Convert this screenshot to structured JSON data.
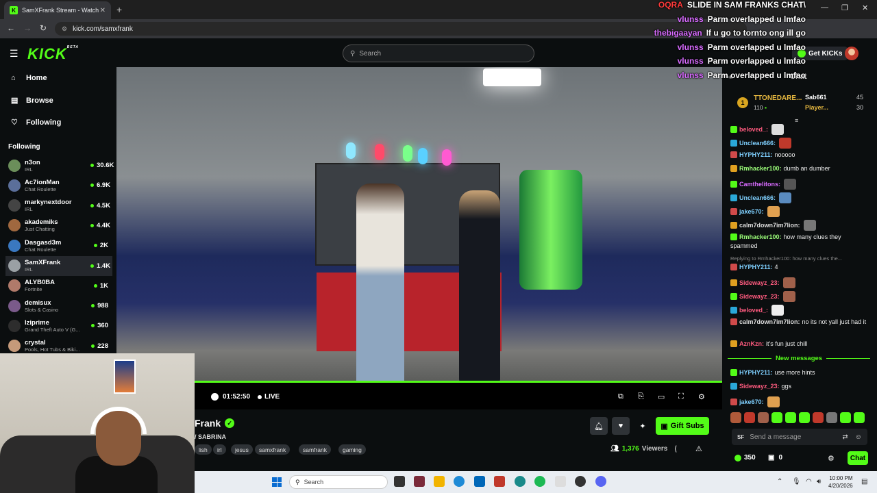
{
  "browser": {
    "tab_title": "SamXFrank Stream - Watch",
    "url": "kick.com/samxfrank",
    "tab_close": "✕",
    "new_tab": "+",
    "win_min": "—",
    "win_max": "❐",
    "win_close": "✕"
  },
  "header": {
    "logo": "KICK",
    "logo_tag": "BETA",
    "search_placeholder": "Search",
    "get_kicks_label": "Get KICKs"
  },
  "sidebar": {
    "nav": [
      {
        "label": "Home",
        "icon": "home-icon"
      },
      {
        "label": "Browse",
        "icon": "browse-icon"
      },
      {
        "label": "Following",
        "icon": "heart-icon"
      }
    ],
    "following_header": "Following",
    "following": [
      {
        "name": "n3on",
        "category": "IRL",
        "viewers": "30.6K",
        "color": "#6b8e5a"
      },
      {
        "name": "Ac7ionMan",
        "category": "Chat Roulette",
        "viewers": "6.9K",
        "color": "#5b6f9a"
      },
      {
        "name": "markynextdoor",
        "category": "IRL",
        "viewers": "4.5K",
        "color": "#444"
      },
      {
        "name": "akademiks",
        "category": "Just Chatting",
        "viewers": "4.4K",
        "color": "#a0683f"
      },
      {
        "name": "Dasgasd3m",
        "category": "Chat Roulette",
        "viewers": "2K",
        "color": "#3a78c0"
      },
      {
        "name": "SamXFrank",
        "category": "IRL",
        "viewers": "1.4K",
        "color": "#9aa0a4"
      },
      {
        "name": "ALYB0BA",
        "category": "Fortnite",
        "viewers": "1K",
        "color": "#b07a6a"
      },
      {
        "name": "demisux",
        "category": "Slots & Casino",
        "viewers": "988",
        "color": "#7a5a8a"
      },
      {
        "name": "lziprime",
        "category": "Grand Theft Auto V (G...",
        "viewers": "360",
        "color": "#2d2d2d"
      },
      {
        "name": "crystal",
        "category": "Pools, Hot Tubs & Biki...",
        "viewers": "228",
        "color": "#c59a7a"
      }
    ]
  },
  "player": {
    "time": "01:52:50",
    "live_label": "LIVE"
  },
  "stream": {
    "streamer_name": "Frank",
    "title": "/ SABRINA",
    "tags": [
      "lish",
      "irl",
      "jesus",
      "samxfrank",
      "samfrank",
      "gaming"
    ],
    "gift_subs_label": "Gift Subs",
    "viewers_count": "1,376",
    "viewers_label": "Viewers"
  },
  "overlay_chat": [
    {
      "user": "OQRA",
      "msg": "SLIDE IN SAM FRANKS CHAT\\",
      "color": "#ff3b3b"
    },
    {
      "user": "vlunss",
      "msg": "Parm overlapped u lmfao",
      "color": "#d86bff"
    },
    {
      "user": "thebigaayan",
      "msg": "If u go to tornto ong ill go",
      "color": "#d86bff"
    },
    {
      "user": "vlunss",
      "msg": "Parm overlapped u lmfao",
      "color": "#d86bff"
    },
    {
      "user": "vlunss",
      "msg": "Parm overlapped u lmfao",
      "color": "#d86bff"
    },
    {
      "user": "vlunss",
      "msg": "Parm overlapped u lmfao",
      "color": "#d86bff"
    }
  ],
  "chat": {
    "title": "Chat",
    "leader_rank": "1",
    "leader_name": "TTONEDARE...",
    "leader_count": "110",
    "leaderboard": [
      {
        "name": "Sab661",
        "value": "45"
      },
      {
        "name": "Player...",
        "value": "30"
      }
    ],
    "messages": [
      {
        "user": "beloved_:",
        "text": "",
        "color": "#ff5b7f",
        "emote": "#ddd"
      },
      {
        "user": "Unclean666:",
        "text": "",
        "color": "#7fd0ff",
        "emote": "#c0392b"
      },
      {
        "user": "HYPHY211:",
        "text": "nooooo",
        "color": "#7fd0ff",
        "emote": ""
      },
      {
        "user": "Rmhacker100:",
        "text": "dumb an dumber",
        "color": "#9cff7a",
        "emote": ""
      },
      {
        "user": "Camthelitons:",
        "text": "",
        "color": "#d86bff",
        "emote": "#555"
      },
      {
        "user": "Unclean666:",
        "text": "",
        "color": "#7fd0ff",
        "emote": "#5a8bbf"
      },
      {
        "user": "jake670:",
        "text": "",
        "color": "#7fd0ff",
        "emote": "#e0a050"
      },
      {
        "user": "calm7down7im7lion:",
        "text": "",
        "color": "#ddd",
        "emote": "#777"
      },
      {
        "user": "Rmhacker100:",
        "text": "how many clues they",
        "color": "#9cff7a",
        "emote": ""
      },
      {
        "user": "",
        "text": "spammed",
        "color": "#fff",
        "emote": ""
      },
      {
        "user": "HYPHY211:",
        "text": "4",
        "color": "#7fd0ff",
        "emote": ""
      },
      {
        "user": "Sidewayz_23:",
        "text": "",
        "color": "#ff5b7f",
        "emote": "#a0604a"
      },
      {
        "user": "Sidewayz_23:",
        "text": "",
        "color": "#ff5b7f",
        "emote": "#a0604a"
      },
      {
        "user": "beloved_:",
        "text": "",
        "color": "#ff5b7f",
        "emote": "#eee"
      },
      {
        "user": "calm7down7im7lion:",
        "text": "no its not yall just had it",
        "color": "#ddd",
        "emote": ""
      },
      {
        "user": "AznKzn:",
        "text": "it's fun just chill",
        "color": "#ff5b7f",
        "emote": ""
      },
      {
        "user": "HYPHY211:",
        "text": "use more hints",
        "color": "#7fd0ff",
        "emote": ""
      },
      {
        "user": "Sidewayz_23:",
        "text": "ggs",
        "color": "#ff5b7f",
        "emote": ""
      },
      {
        "user": "jake670:",
        "text": "",
        "color": "#7fd0ff",
        "emote": "#e0a050"
      }
    ],
    "reply_line": "Replying to Rmhacker100: how many clues the...",
    "new_messages_label": "New messages",
    "input_placeholder": "Send a message",
    "input_prefix": "SF",
    "kicks_count": "350",
    "gifts_count": "0",
    "send_label": "Chat"
  },
  "taskbar": {
    "search_placeholder": "Search",
    "time": "10:00 PM",
    "date": "4/20/2026"
  },
  "colors": {
    "accent": "#53fc18",
    "background": "#0b0e0f"
  }
}
